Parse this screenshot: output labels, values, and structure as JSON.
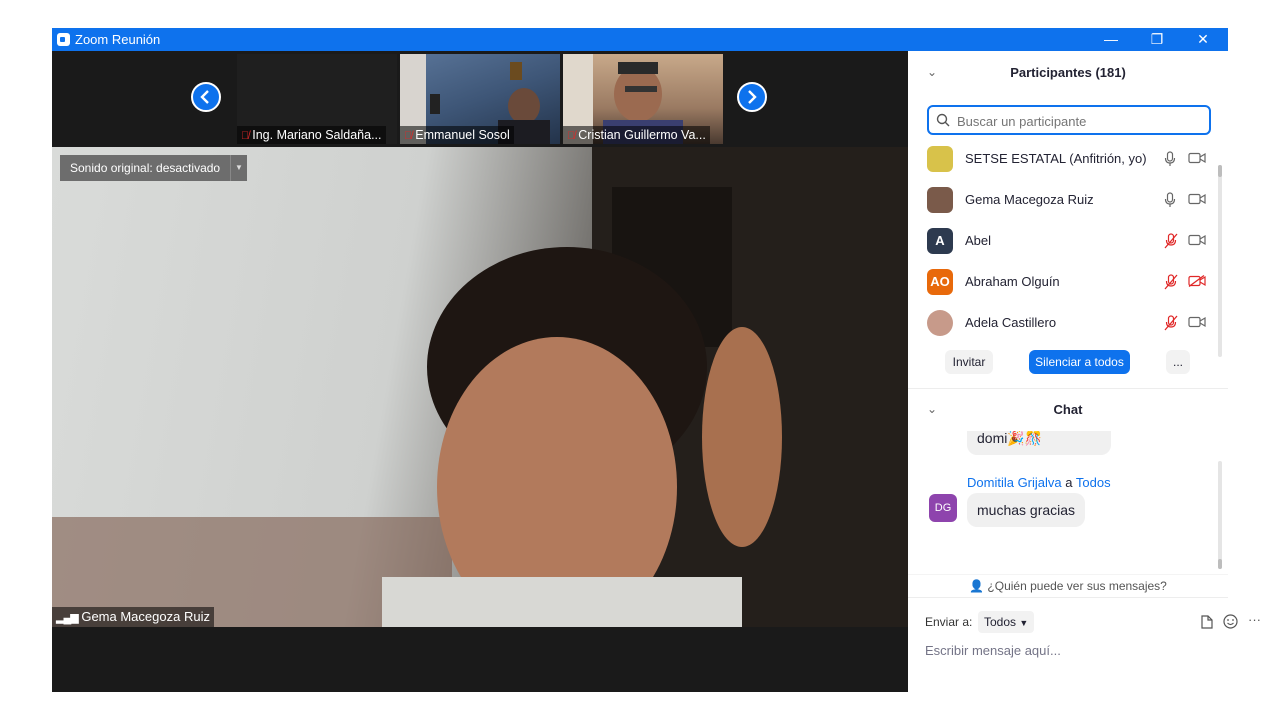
{
  "window": {
    "title": "Zoom Reunión",
    "controls": {
      "minimize": "—",
      "restore": "❐",
      "close": "✕"
    }
  },
  "video": {
    "thumbnails": [
      {
        "name": "Ing. Mariano Saldaña...",
        "muted": true
      },
      {
        "name": "Emmanuel Sosol",
        "muted": true
      },
      {
        "name": "Cristian Guillermo Va...",
        "muted": true
      }
    ],
    "original_sound": "Sonido original: desactivado",
    "speaker_name": "Gema Macegoza Ruiz"
  },
  "participants": {
    "header": "Participantes (181)",
    "search_placeholder": "Buscar un participante",
    "list": [
      {
        "name": "SETSE ESTATAL (Anfitrión, yo)",
        "avatar_text": "",
        "avatar_color": "#d8c24a",
        "mic": "on",
        "video": "off"
      },
      {
        "name": "Gema Macegoza Ruiz",
        "avatar_text": "",
        "avatar_color": "#7a5a4a",
        "mic": "on",
        "video": "off"
      },
      {
        "name": "Abel",
        "avatar_text": "A",
        "avatar_color": "#2d3a4f",
        "mic": "muted",
        "video": "off"
      },
      {
        "name": "Abraham Olguín",
        "avatar_text": "AO",
        "avatar_color": "#e8690b",
        "mic": "muted",
        "video": "muted"
      },
      {
        "name": "Adela Castillero",
        "avatar_text": "",
        "avatar_color": "#c79a8a",
        "mic": "muted",
        "video": "off"
      }
    ],
    "buttons": {
      "invite": "Invitar",
      "mute_all": "Silenciar a todos",
      "more": "..."
    }
  },
  "chat": {
    "header": "Chat",
    "prev_message": "domi🎉🎊",
    "messages": [
      {
        "sender": "Domitila Grijalva",
        "connector": "a",
        "recipient": "Todos",
        "avatar_text": "DG",
        "avatar_color": "#8e44ad",
        "text": "muchas gracias"
      }
    ],
    "who_can_see": "¿Quién puede ver sus mensajes?",
    "send_to_label": "Enviar a:",
    "send_to_value": "Todos",
    "compose_placeholder": "Escribir mensaje aquí...",
    "more": "···"
  },
  "colors": {
    "accent": "#0e72ed",
    "muted": "#e02828",
    "titlebar": "#0e72ed"
  }
}
